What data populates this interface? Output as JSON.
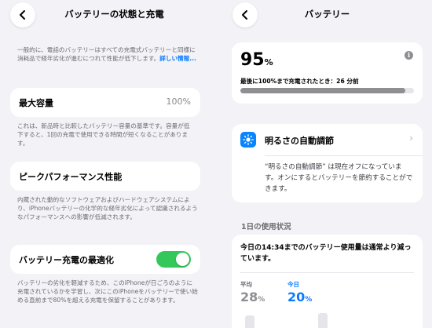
{
  "left": {
    "title": "バッテリーの状態と充電",
    "intro_text": "一般的に、電話のバッテリーはすべての充電式バッテリーと同様に消耗品で経年劣化が進むにつれて性能が低下します。",
    "intro_link": "詳しい情報...",
    "max_capacity": {
      "label": "最大容量",
      "value": "100%",
      "description": "これは、新品時と比較したバッテリー容量の基準です。容量が低下すると、1回の充電で使用できる時間が短くなることがあります。"
    },
    "peak_performance": {
      "label": "ピークパフォーマンス性能",
      "description": "内蔵された動的なソフトウェアおよびハードウェアシステムにより、iPhoneバッテリーの化学的な経年劣化によって認識されるようなパフォーマンスへの影響が低減されます。"
    },
    "optimized_charging": {
      "label": "バッテリー充電の最適化",
      "enabled": true,
      "description": "バッテリーの劣化を軽減するため、このiPhoneが日ごろのように充電されているかを学習し、次にこのiPhoneをバッテリーで使い始める直前まで80%を超える充電を保留することがあります。"
    }
  },
  "right": {
    "title": "バッテリー",
    "battery": {
      "percent": "95",
      "unit": "%",
      "last_charged": "最後に100%まで充電されたとき：26 分前",
      "level_fraction": 0.95
    },
    "auto_brightness": {
      "label": "明るさの自動調節",
      "description": "“明るさの自動調節” は現在オフになっています。オンにするとバッテリーを節約することができます。"
    },
    "usage": {
      "section_header": "1日の使用状況",
      "headline": "今日の14:34までのバッテリー使用量は通常より減っています。",
      "average_label": "平均",
      "average_value": "28",
      "today_label": "今日",
      "today_value": "20",
      "unit": "%"
    }
  },
  "colors": {
    "accent_blue": "#0a7aff",
    "toggle_green": "#34c759",
    "background": "#f2f2f7"
  },
  "icons": {
    "back": "chevron-left-icon",
    "info": "info-icon",
    "brightness": "sun-icon",
    "disclosure": "chevron-right-icon"
  }
}
